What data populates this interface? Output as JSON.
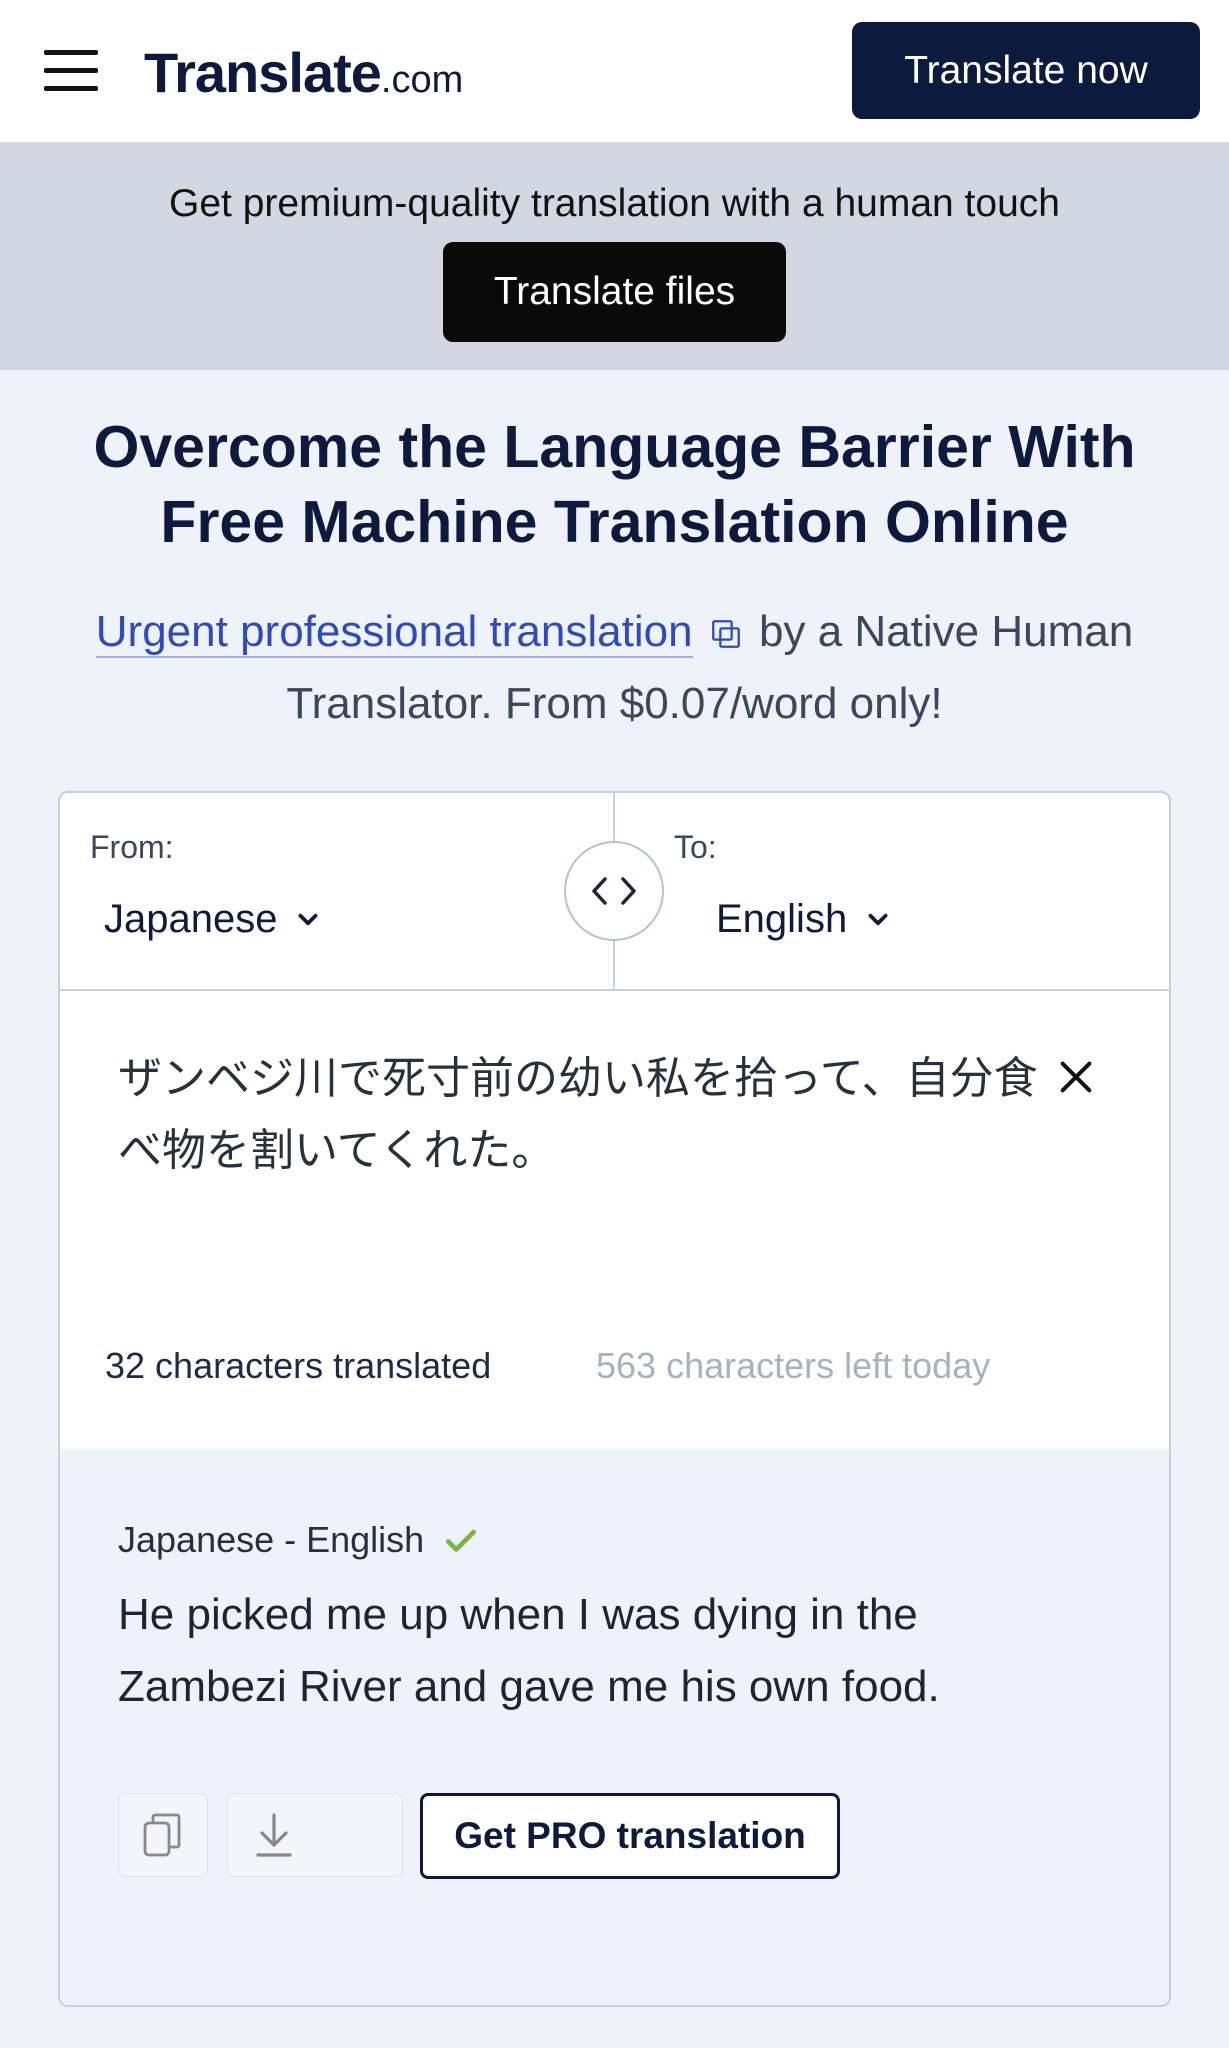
{
  "header": {
    "logo_main": "Translate",
    "logo_domain": ".com",
    "cta_label": "Translate now",
    "menu_icon": "hamburger-menu-icon"
  },
  "promo": {
    "text": "Get premium-quality translation with a human touch",
    "button_label": "Translate files"
  },
  "hero": {
    "headline_line1": "Overcome the Language Barrier With",
    "headline_line2": "Free Machine Translation Online",
    "link_text": "Urgent professional translation",
    "link_icon": "external-link-icon",
    "sub_after_link": " by a Native Human Translator. From $0.07/word only!"
  },
  "translator": {
    "from_label": "From:",
    "from_value": "Japanese",
    "to_label": "To:",
    "to_value": "English",
    "swap_icon": "swap-arrows-icon",
    "source_text": "ザンベジ川で死寸前の幼い私を拾って、自分食べ物を割いてくれた。",
    "clear_icon": "close-icon",
    "chars_translated": "32 characters translated",
    "chars_left": "563 characters left today",
    "pair_label": "Japanese - English",
    "pair_status_icon": "checkmark-icon",
    "output_text": "He picked me up when I was dying in the Zambezi River and gave me his own food.",
    "copy_icon": "copy-icon",
    "download_icon": "download-icon",
    "pro_button_label": "Get PRO translation"
  },
  "colors": {
    "brand_navy": "#0c1a3d",
    "link_blue": "#2d4bc0",
    "success_green": "#7cb342",
    "promo_bg": "#d3d7e1",
    "output_bg": "#f0f2fb"
  }
}
